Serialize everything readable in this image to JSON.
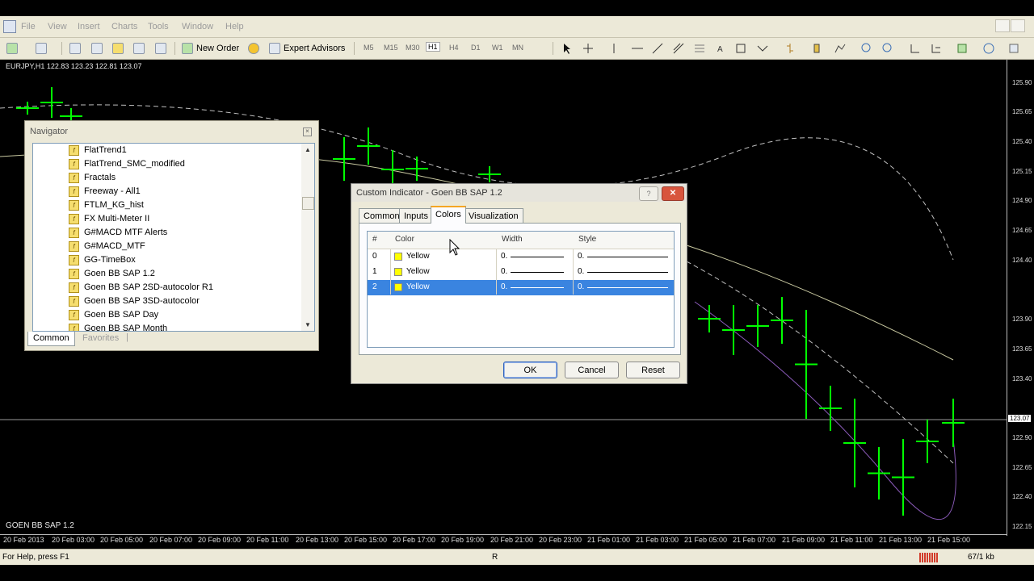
{
  "menu": {
    "items": [
      "File",
      "View",
      "Insert",
      "Charts",
      "Tools",
      "Window",
      "Help"
    ]
  },
  "toolbar": {
    "new_order": "New Order",
    "expert_advisors": "Expert Advisors",
    "timeframes": [
      "M5",
      "M15",
      "M30",
      "H1",
      "H4",
      "D1",
      "W1",
      "MN"
    ],
    "selected_timeframe": "H1"
  },
  "chart": {
    "symbol_info": "EURJPY,H1  122.83 123.23 122.81 123.07",
    "indicator_label": "GOEN BB SAP 1.2",
    "current_price": "123.07",
    "price_labels": [
      "125.90",
      "125.65",
      "125.40",
      "125.15",
      "124.90",
      "124.65",
      "124.40",
      "123.90",
      "123.65",
      "123.40",
      "122.90",
      "122.65",
      "122.40",
      "122.15"
    ],
    "time_labels": [
      "20 Feb 2013",
      "20 Feb 03:00",
      "20 Feb 05:00",
      "20 Feb 07:00",
      "20 Feb 09:00",
      "20 Feb 11:00",
      "20 Feb 13:00",
      "20 Feb 15:00",
      "20 Feb 17:00",
      "20 Feb 19:00",
      "20 Feb 21:00",
      "20 Feb 23:00",
      "21 Feb 01:00",
      "21 Feb 03:00",
      "21 Feb 05:00",
      "21 Feb 07:00",
      "21 Feb 09:00",
      "21 Feb 11:00",
      "21 Feb 13:00",
      "21 Feb 15:00"
    ],
    "colors": {
      "bars": "#00ff00",
      "ma_light": "#c8c8a0",
      "ma_dash": "#bfbfbf",
      "ma_purple": "#8a5ab8"
    }
  },
  "navigator": {
    "title": "Navigator",
    "items": [
      "FlatTrend1",
      "FlatTrend_SMC_modified",
      "Fractals",
      "Freeway - All1",
      "FTLM_KG_hist",
      "FX Multi-Meter II",
      "G#MACD MTF Alerts",
      "G#MACD_MTF",
      "GG-TimeBox",
      "Goen BB SAP 1.2",
      "Goen BB SAP 2SD-autocolor R1",
      "Goen BB SAP 3SD-autocolor",
      "Goen BB SAP Day",
      "Goen BB SAP Month"
    ],
    "tabs": [
      "Common",
      "Favorites"
    ],
    "active_tab": "Common"
  },
  "dialog": {
    "title": "Custom Indicator - Goen BB SAP 1.2",
    "help": "?",
    "tabs": [
      "Common",
      "Inputs",
      "Colors",
      "Visualization"
    ],
    "active_tab": "Colors",
    "columns": [
      "#",
      "Color",
      "Width",
      "Style"
    ],
    "rows": [
      {
        "index": "0",
        "color": "Yellow",
        "width": "0."
      },
      {
        "index": "1",
        "color": "Yellow",
        "width": "0."
      },
      {
        "index": "2",
        "color": "Yellow",
        "width": "0."
      }
    ],
    "selected_row": 2,
    "swatch_color": "#ffff00",
    "buttons": {
      "ok": "OK",
      "cancel": "Cancel",
      "reset": "Reset"
    }
  },
  "status": {
    "help_text": "For Help, press F1",
    "mode": "R",
    "traffic": "67/1 kb"
  }
}
